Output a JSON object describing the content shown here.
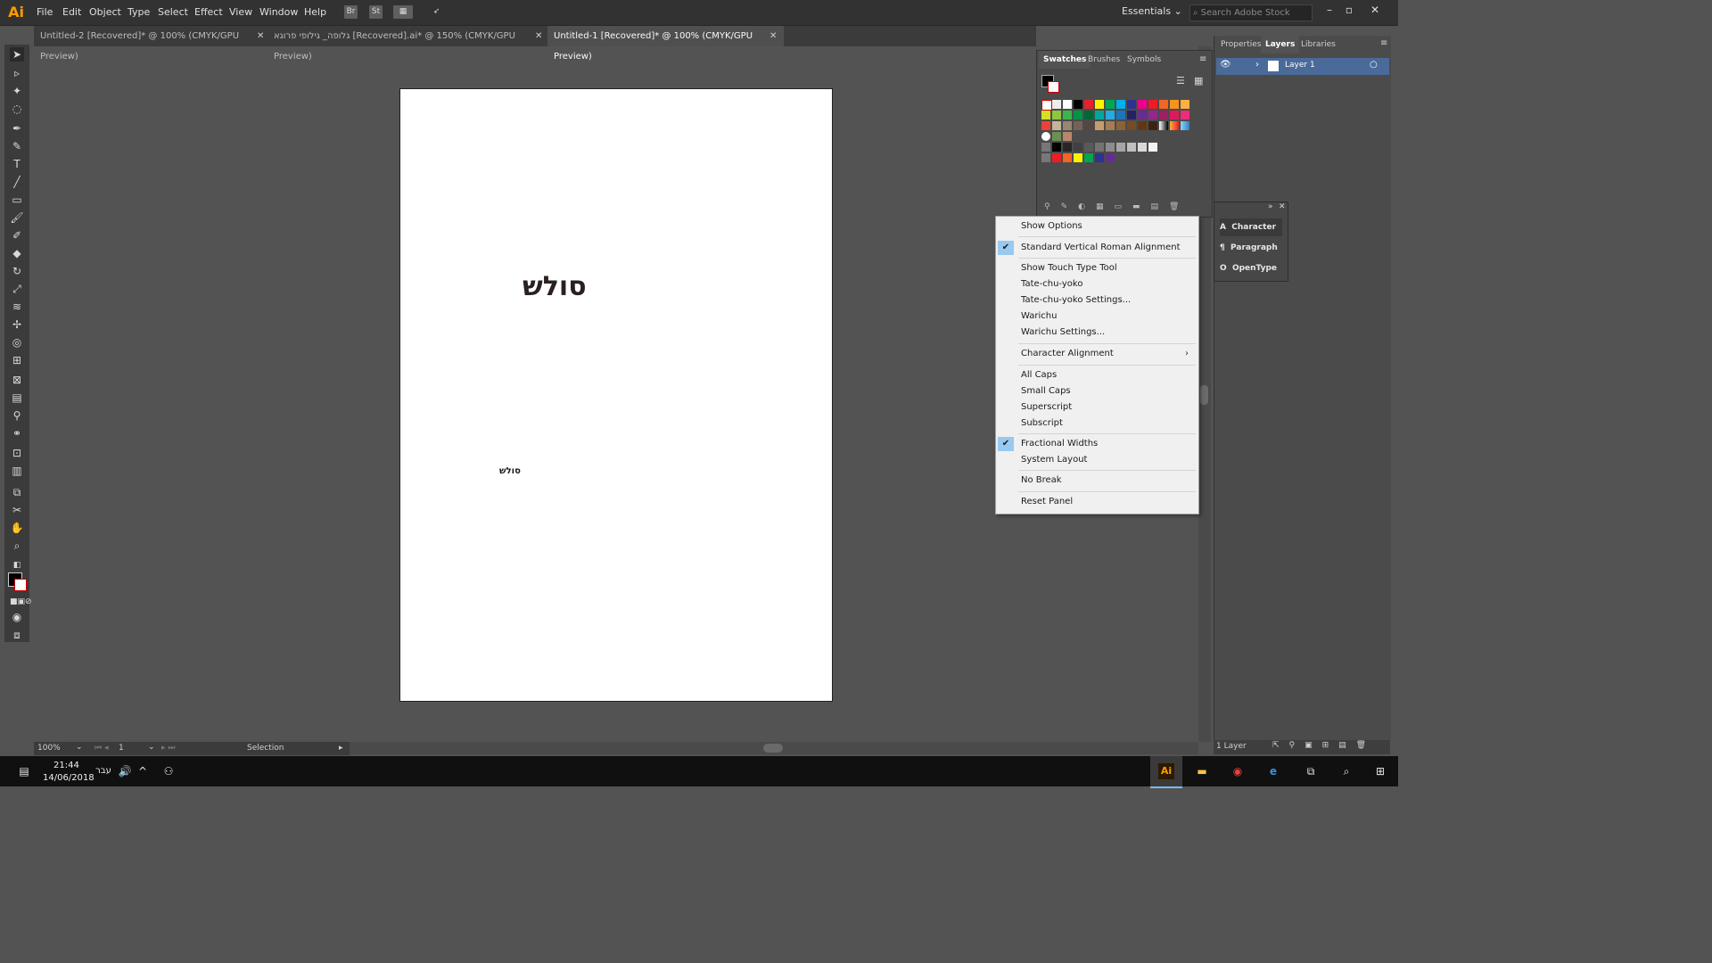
{
  "app": {
    "logo": "Ai"
  },
  "menu": [
    "File",
    "Edit",
    "Object",
    "Type",
    "Select",
    "Effect",
    "View",
    "Window",
    "Help"
  ],
  "top_icons": [
    "Br",
    "St"
  ],
  "workspace": "Essentials",
  "search_placeholder": "Search Adobe Stock",
  "tabs": [
    {
      "label": "Untitled-2 [Recovered]* @ 100% (CMYK/GPU Preview)"
    },
    {
      "label": "גלופה_ גילופי פרוגא [Recovered].ai* @ 150% (CMYK/GPU Preview)"
    },
    {
      "label": "Untitled-1 [Recovered]* @ 100% (CMYK/GPU Preview)"
    }
  ],
  "canvas": {
    "heading": "סולש",
    "small": "סולש"
  },
  "status": {
    "zoom": "100%",
    "page": "1",
    "tool": "Selection"
  },
  "swatches_panel": {
    "tabs": [
      "Swatches",
      "Brushes",
      "Symbols"
    ]
  },
  "layers_panel": {
    "tabs": [
      "Properties",
      "Layers",
      "Libraries"
    ],
    "layer_name": "Layer 1",
    "footer": "1 Layer"
  },
  "char_panel": {
    "items": [
      "Character",
      "Paragraph",
      "OpenType"
    ]
  },
  "context_menu": {
    "items": [
      {
        "label": "Show Options",
        "checked": false
      },
      {
        "label": "Standard Vertical Roman Alignment",
        "checked": true
      },
      {
        "label": "Show Touch Type Tool",
        "checked": false
      },
      {
        "label": "Tate-chu-yoko",
        "checked": false
      },
      {
        "label": "Tate-chu-yoko Settings...",
        "checked": false
      },
      {
        "label": "Warichu",
        "checked": false
      },
      {
        "label": "Warichu Settings...",
        "checked": false
      },
      {
        "label": "Character Alignment",
        "checked": false,
        "submenu": true
      },
      {
        "label": "All Caps",
        "checked": false
      },
      {
        "label": "Small Caps",
        "checked": false
      },
      {
        "label": "Superscript",
        "checked": false
      },
      {
        "label": "Subscript",
        "checked": false
      },
      {
        "label": "Fractional Widths",
        "checked": true
      },
      {
        "label": "System Layout",
        "checked": false
      },
      {
        "label": "No Break",
        "checked": false
      },
      {
        "label": "Reset Panel",
        "checked": false
      }
    ]
  },
  "taskbar": {
    "time": "21:44",
    "date": "14/06/2018",
    "lang": "עבר"
  },
  "colors": {
    "menu_bg": "#323232",
    "canvas_bg": "#535353",
    "accent": "#4a6a9a",
    "ai_orange": "#ff9a00"
  }
}
